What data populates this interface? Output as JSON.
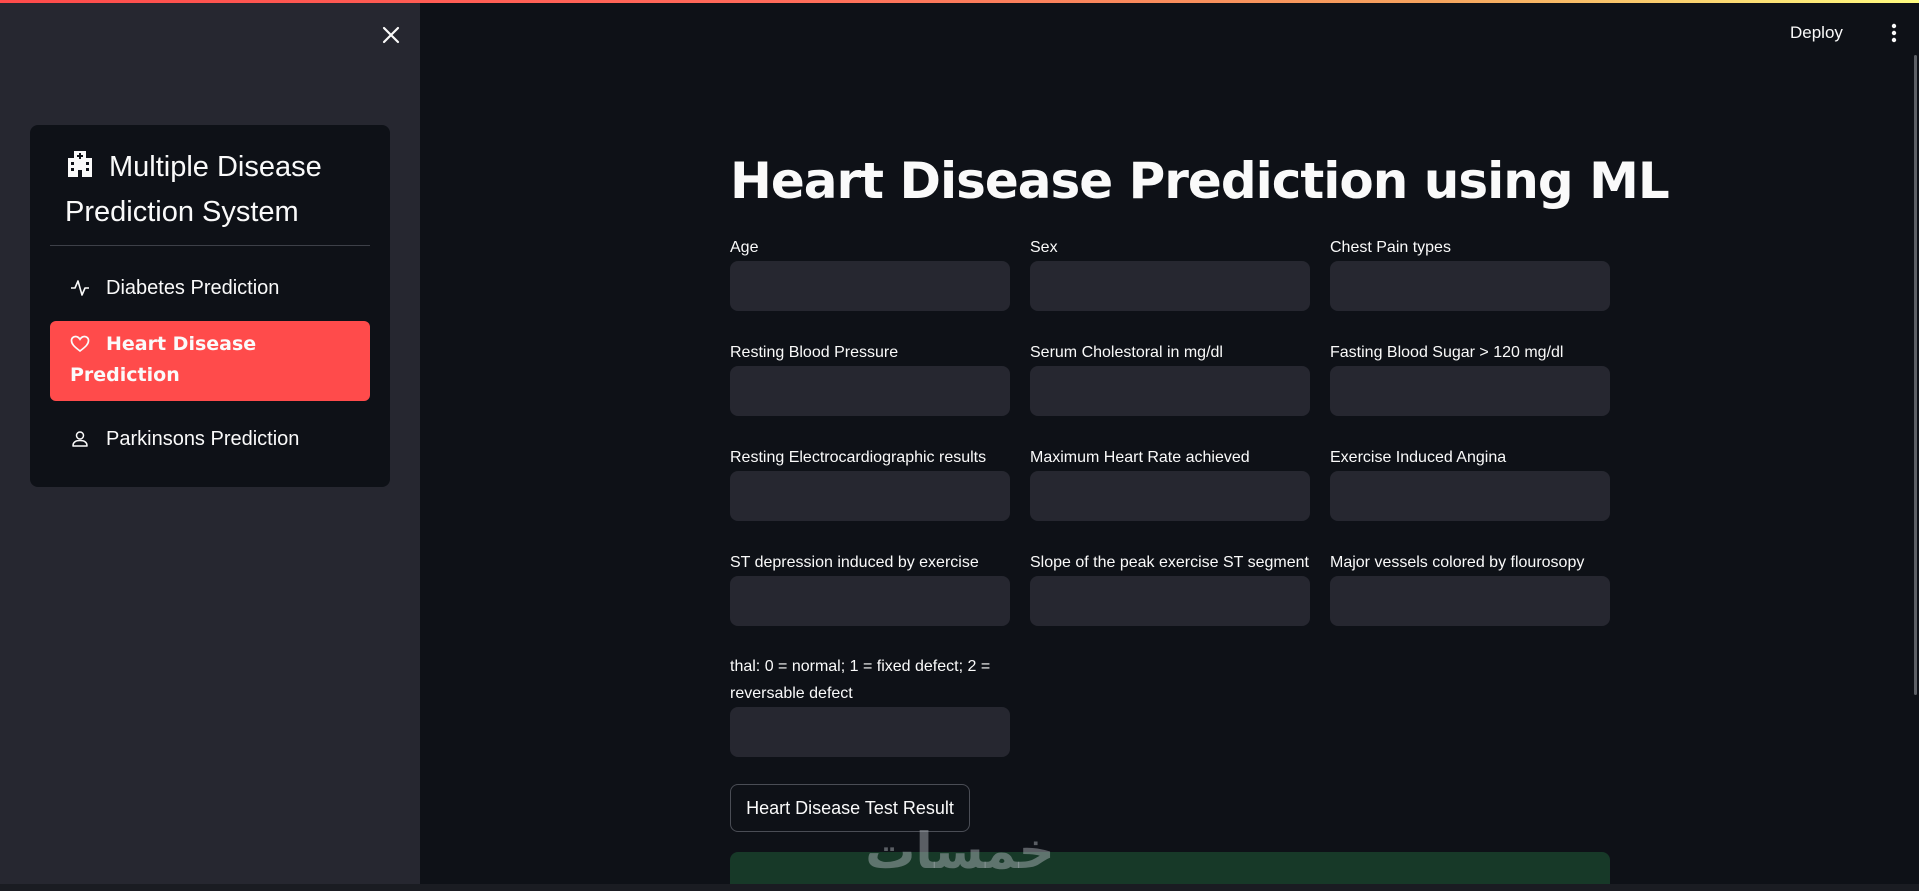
{
  "sidebar": {
    "close_icon": "close-icon",
    "title": "Multiple Disease Prediction System",
    "title_icon": "hospital-icon",
    "items": [
      {
        "label": "Diabetes Prediction",
        "icon": "activity-icon",
        "active": false
      },
      {
        "label": "Heart Disease Prediction",
        "icon": "heart-icon",
        "active": true
      },
      {
        "label": "Parkinsons Prediction",
        "icon": "person-icon",
        "active": false
      }
    ],
    "active_color": "#ff4b4b"
  },
  "header": {
    "deploy_label": "Deploy",
    "more_icon": "vertical-dots-icon"
  },
  "main": {
    "title": "Heart Disease Prediction using ML",
    "fields": [
      {
        "label": "Age",
        "value": ""
      },
      {
        "label": "Sex",
        "value": ""
      },
      {
        "label": "Chest Pain types",
        "value": ""
      },
      {
        "label": "Resting Blood Pressure",
        "value": ""
      },
      {
        "label": "Serum Cholestoral in mg/dl",
        "value": ""
      },
      {
        "label": "Fasting Blood Sugar > 120 mg/dl",
        "value": ""
      },
      {
        "label": "Resting Electrocardiographic results",
        "value": ""
      },
      {
        "label": "Maximum Heart Rate achieved",
        "value": ""
      },
      {
        "label": "Exercise Induced Angina",
        "value": ""
      },
      {
        "label": "ST depression induced by exercise",
        "value": ""
      },
      {
        "label": "Slope of the peak exercise ST segment",
        "value": ""
      },
      {
        "label": "Major vessels colored by flourosopy",
        "value": ""
      },
      {
        "label": "thal: 0 = normal; 1 = fixed defect; 2 = reversable defect",
        "value": ""
      }
    ],
    "submit_label": "Heart Disease Test Result",
    "result_color": "#173928"
  },
  "watermark_text": "خمسات"
}
